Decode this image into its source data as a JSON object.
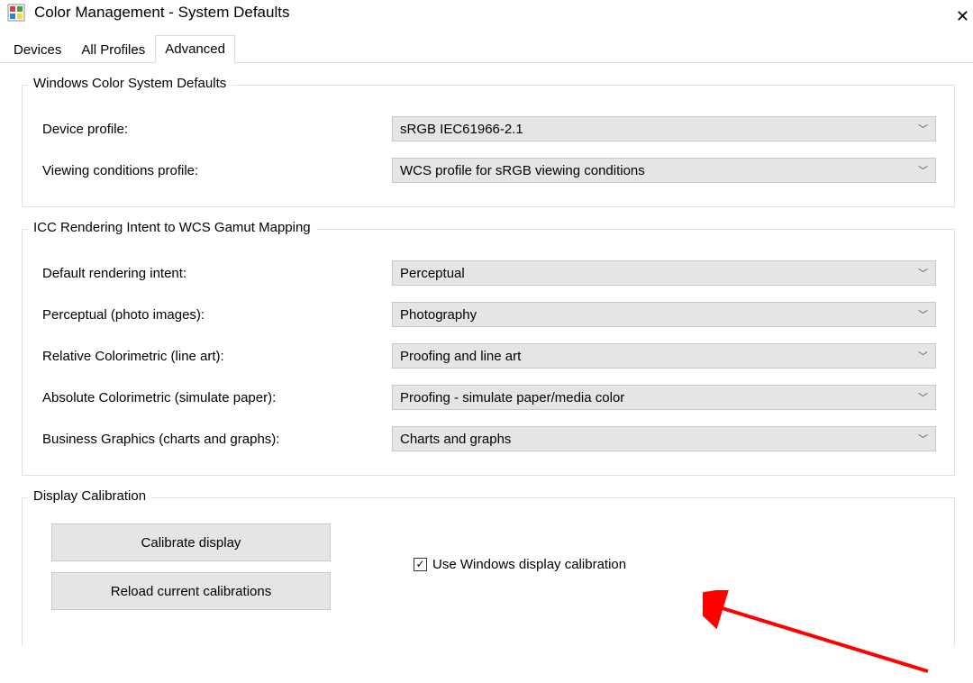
{
  "window": {
    "title": "Color Management - System Defaults"
  },
  "tabs": {
    "devices": "Devices",
    "all_profiles": "All Profiles",
    "advanced": "Advanced"
  },
  "groups": {
    "wcs_defaults": {
      "title": "Windows Color System Defaults",
      "device_profile_label": "Device profile:",
      "device_profile_value": "sRGB IEC61966-2.1",
      "viewing_conditions_label": "Viewing conditions profile:",
      "viewing_conditions_value": "WCS profile for sRGB viewing conditions"
    },
    "gamut": {
      "title": "ICC Rendering Intent to WCS Gamut Mapping",
      "default_intent_label": "Default rendering intent:",
      "default_intent_value": "Perceptual",
      "perceptual_label": "Perceptual (photo images):",
      "perceptual_value": "Photography",
      "rel_color_label": "Relative Colorimetric (line art):",
      "rel_color_value": "Proofing and line art",
      "abs_color_label": "Absolute Colorimetric (simulate paper):",
      "abs_color_value": "Proofing - simulate paper/media color",
      "business_label": "Business Graphics (charts and graphs):",
      "business_value": "Charts and graphs"
    },
    "calibration": {
      "title": "Display Calibration",
      "calibrate_btn": "Calibrate display",
      "reload_btn": "Reload current calibrations",
      "use_windows_calib": "Use Windows display calibration"
    }
  }
}
